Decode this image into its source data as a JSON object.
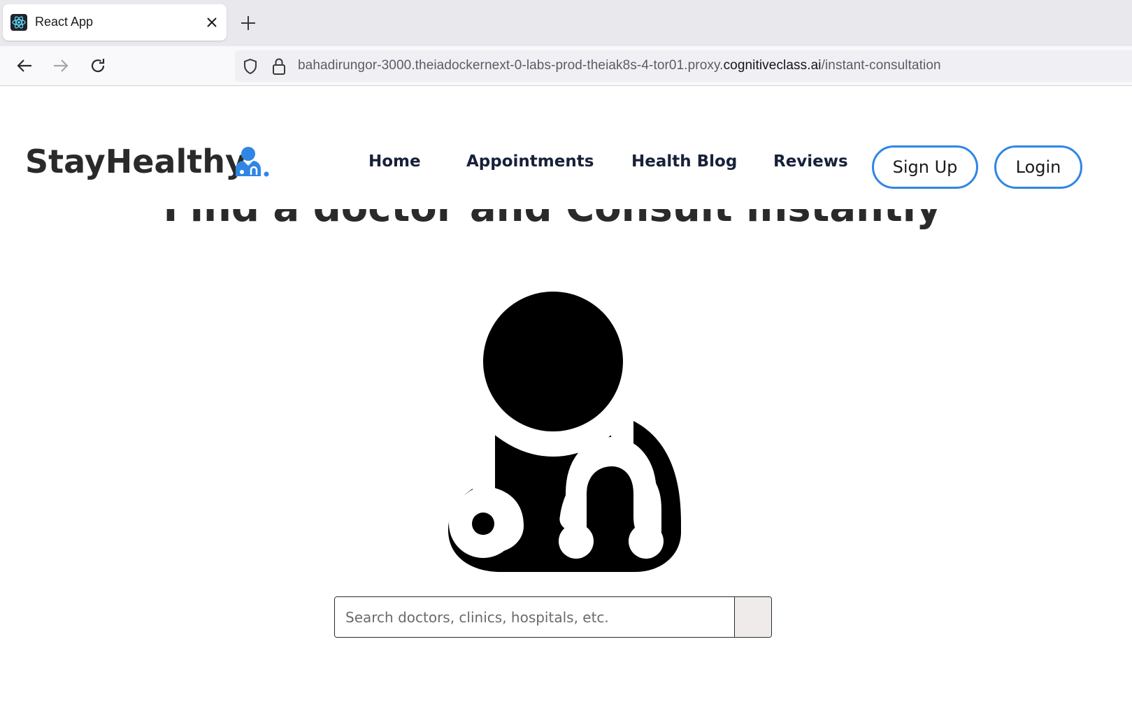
{
  "browser": {
    "tab_title": "React App",
    "url_prefix": "bahadirungor-3000.theiadockernext-0-labs-prod-theiak8s-4-tor01.proxy.",
    "url_host": "cognitiveclass.ai",
    "url_path": "/instant-consultation"
  },
  "site": {
    "logo_text": "StayHealthy",
    "nav": {
      "home": "Home",
      "appointments": "Appointments",
      "health_blog": "Health Blog",
      "reviews": "Reviews"
    },
    "signup_label": "Sign Up",
    "login_label": "Login",
    "accent_color": "#2f86e5"
  },
  "main": {
    "title": "Find a doctor and Consult instantly",
    "search_placeholder": "Search doctors, clinics, hospitals, etc."
  }
}
